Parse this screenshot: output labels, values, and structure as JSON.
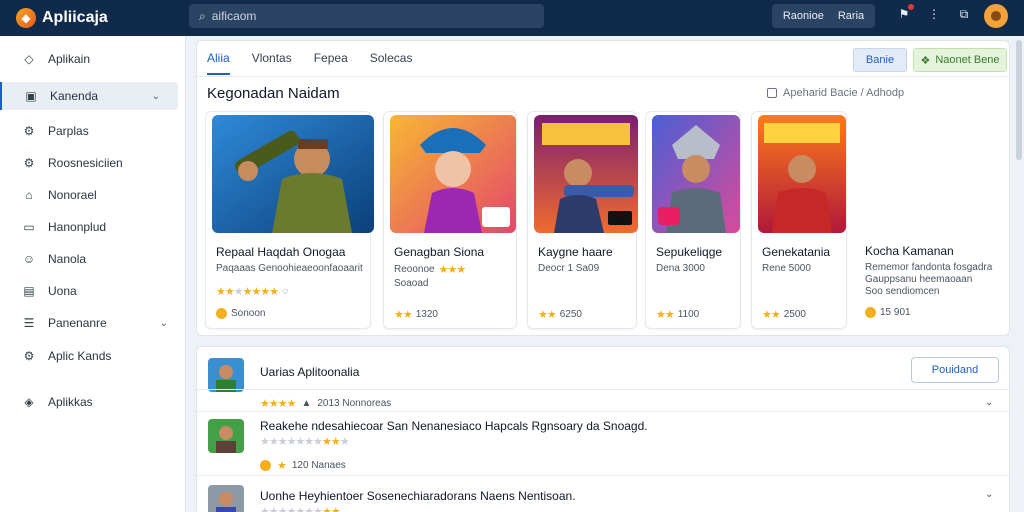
{
  "app": {
    "name": "Apliicaja"
  },
  "search": {
    "value": "aificaom"
  },
  "topbar": {
    "pill_left": "Raonioe",
    "pill_right": "Raria"
  },
  "sidebar": {
    "items": [
      {
        "label": "Aplikain",
        "icon": "diamond-icon"
      },
      {
        "label": "Kanenda",
        "icon": "square-icon",
        "active": true,
        "expandable": true
      },
      {
        "label": "Parplas",
        "icon": "gear-icon"
      },
      {
        "label": "Roosnesiciien",
        "icon": "gear-icon"
      },
      {
        "label": "Nonorael",
        "icon": "tag-icon"
      },
      {
        "label": "Hanonplud",
        "icon": "box-icon"
      },
      {
        "label": "Nanola",
        "icon": "person-icon"
      },
      {
        "label": "Uona",
        "icon": "gift-icon"
      },
      {
        "label": "Panenanre",
        "icon": "list-icon",
        "expandable": true
      },
      {
        "label": "Aplic Kands",
        "icon": "gear-icon"
      },
      {
        "label": "Aplikkas",
        "icon": "pin-icon"
      }
    ]
  },
  "main": {
    "tabs": [
      {
        "label": "Aliia",
        "active": true
      },
      {
        "label": "Vlontas"
      },
      {
        "label": "Fepea"
      },
      {
        "label": "Solecas"
      }
    ],
    "btn_light": "Banie",
    "btn_green": "Naonet Bene",
    "section_title": "Kegonadan Naidam",
    "section_meta": "Apeharid Bacie / Adhodp",
    "games": [
      {
        "title": "Repaal Haqdah Onogaa",
        "sub": "Paqaaas Genoohieaeoonfaoaarit",
        "sub2": "",
        "rating_text": "Sonoon",
        "stars": 4,
        "art": "hero-green",
        "badge": ""
      },
      {
        "title": "Genagban Siona",
        "sub": "Reoonoe",
        "sub2": "Soaoad",
        "rating_text": "1320",
        "stars": 3,
        "art": "hero-pink",
        "badge": "ROJ"
      },
      {
        "title": "Kaygne haare",
        "sub": "Deocr 1 Sa09",
        "sub2": "",
        "rating_text": "6250",
        "stars": 2,
        "art": "hero-gun",
        "badge": "MASIUKAN"
      },
      {
        "title": "Sepukeliqge",
        "sub": "Dena 3000",
        "sub2": "",
        "rating_text": "1100",
        "stars": 2,
        "art": "hero-knight",
        "badge": ""
      },
      {
        "title": "Genekatania",
        "sub": "Rene 5000",
        "sub2": "",
        "rating_text": "2500",
        "stars": 2,
        "art": "hero-red",
        "badge": "MAWCE"
      },
      {
        "title": "Kocha Kamanan",
        "sub": "Rememor fandonta fosgadra",
        "sub2": "Gauppsanu heemaoaan",
        "sub3": "Soo sendiomcen",
        "rating_text": "15 901",
        "stars": 0,
        "art": "",
        "badge": ""
      }
    ]
  },
  "list": {
    "title": "Uarias Aplitoonalia",
    "button": "Pouidand",
    "rows": [
      {
        "title": "Uarias Aplitoonalia",
        "meta": "2013 Nonnoreas",
        "stars": 3
      },
      {
        "title": "Reakehe ndesahiecoar San Nenanesiaco Hapcals Rgnsoary da Snoagd.",
        "meta": "120 Nanaes",
        "stars": 2
      },
      {
        "title": "Uonhe Heyhientoer Sosenechiaradorans Naens Nentisoan.",
        "meta": "",
        "stars": 2
      }
    ]
  },
  "colors": {
    "accent": "#1f5fbf",
    "topbar": "#0f2a4a",
    "star": "#f2b01e"
  }
}
